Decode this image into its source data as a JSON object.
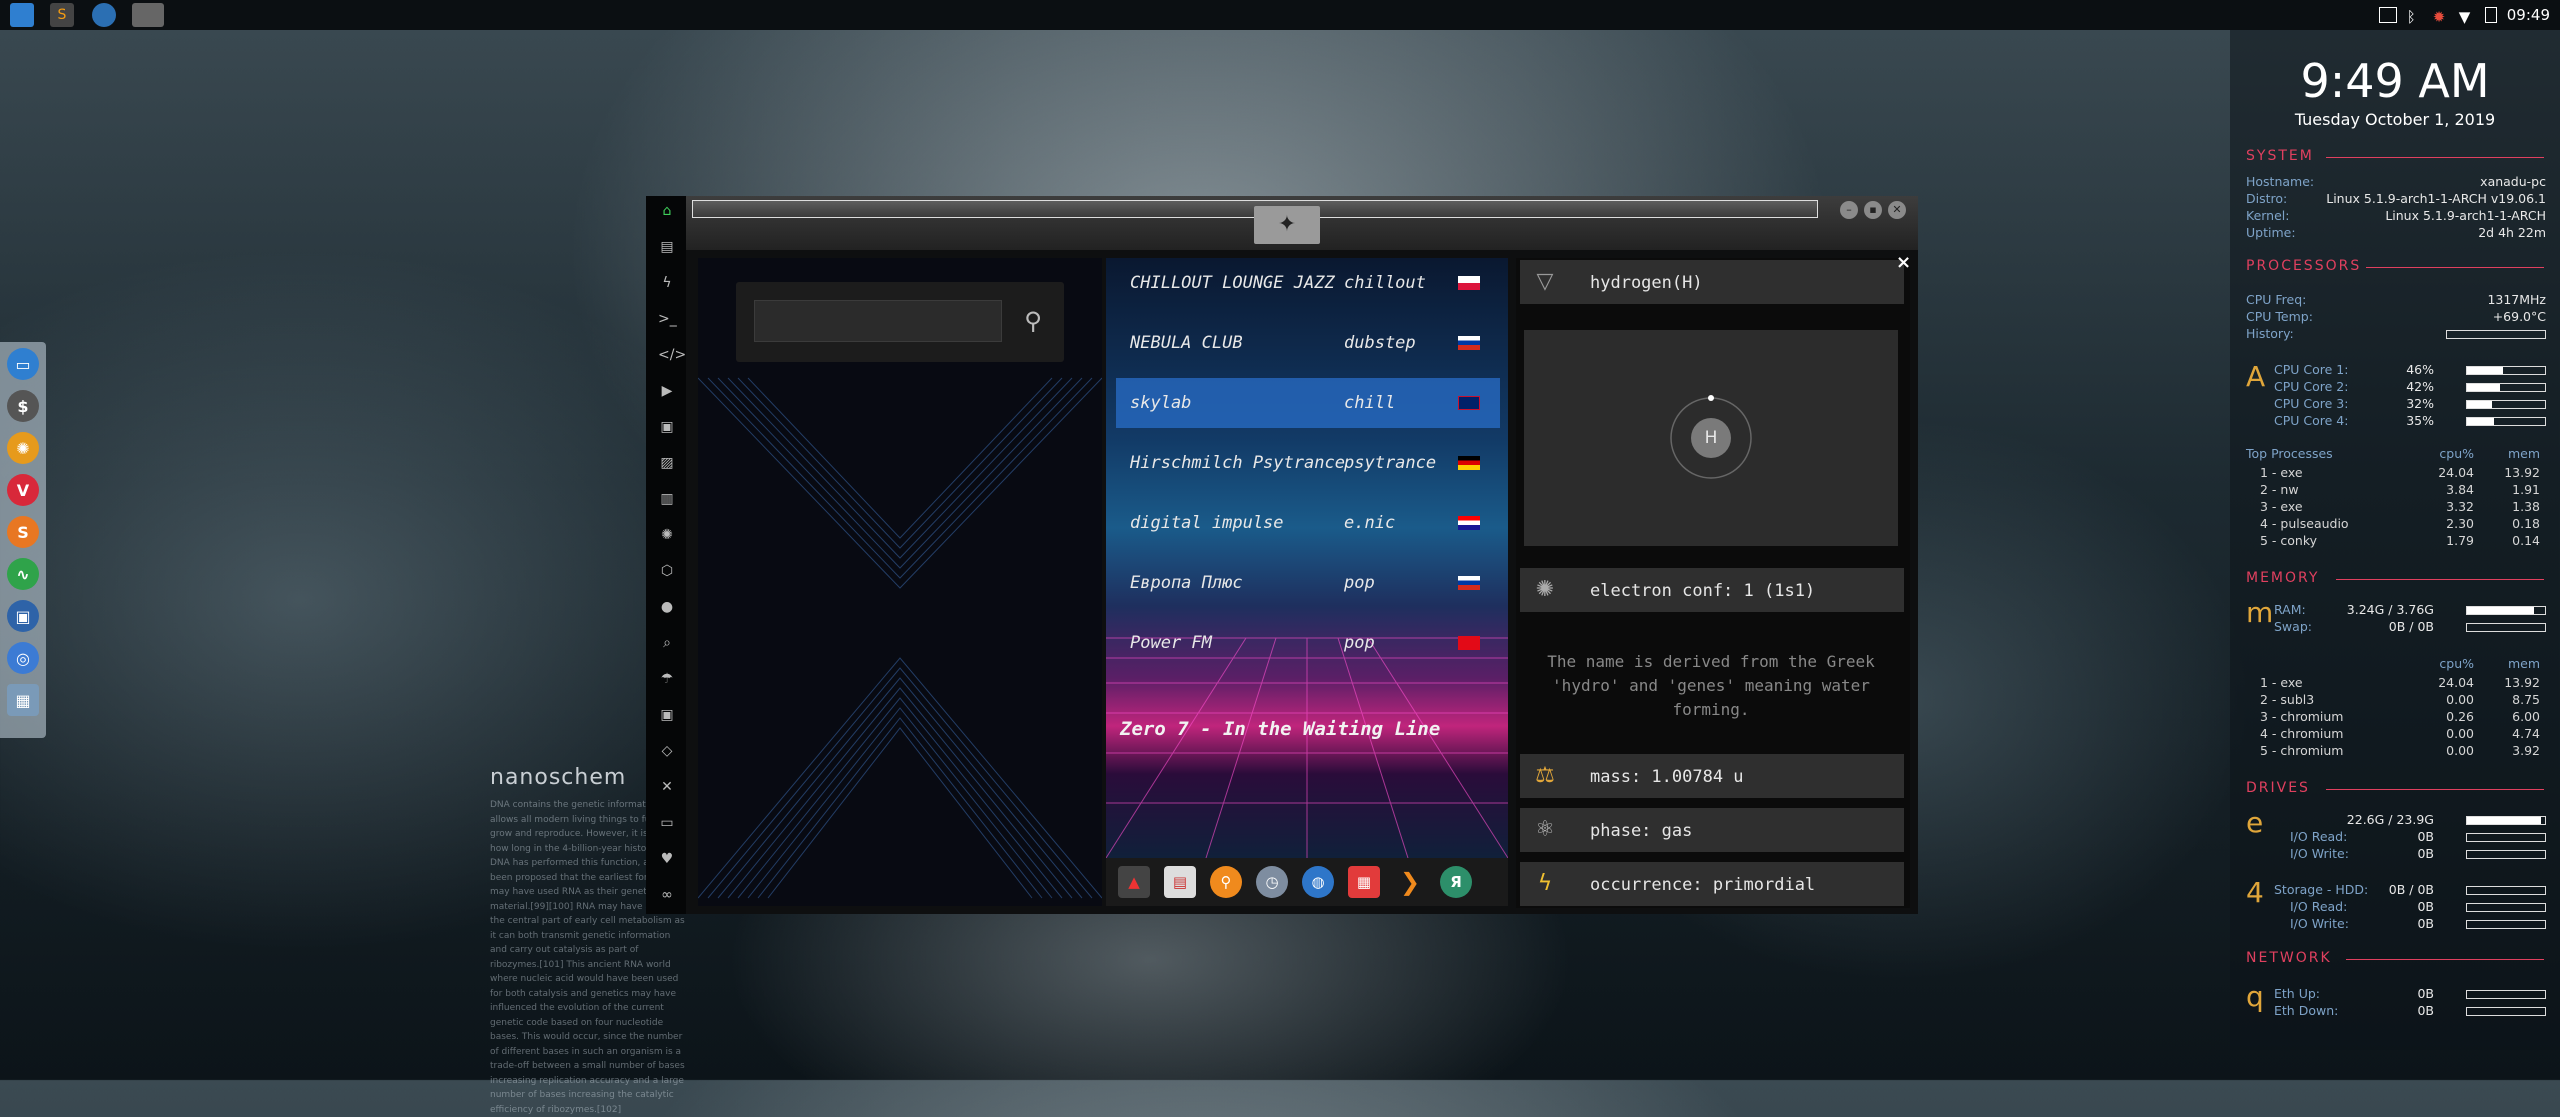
{
  "taskbar": {
    "time": "09:49"
  },
  "search": {
    "placeholder": ""
  },
  "stations": [
    {
      "name": "CHILLOUT LOUNGE JAZZ",
      "genre": "chillout",
      "flag": "poland"
    },
    {
      "name": "NEBULA CLUB",
      "genre": "dubstep",
      "flag": "russia"
    },
    {
      "name": "skylab",
      "genre": "chill",
      "flag": "uk"
    },
    {
      "name": "Hirschmilch Psytrance",
      "genre": "psytrance",
      "flag": "germany"
    },
    {
      "name": "digital impulse",
      "genre": "e.nic",
      "flag": "croatia"
    },
    {
      "name": "Европа Плюс",
      "genre": "pop",
      "flag": "russia"
    },
    {
      "name": "Power FM",
      "genre": "pop",
      "flag": "turkey"
    }
  ],
  "now_playing": "Zero 7 - In the Waiting Line",
  "element": {
    "name": "hydrogen(H)",
    "symbol": "H",
    "electron_conf": "electron conf: 1 (1s1)",
    "description": "The name is derived from the Greek 'hydro' and 'genes' meaning water forming.",
    "mass": "mass: 1.00784 u",
    "phase": "phase: gas",
    "occurrence": "occurrence: primordial"
  },
  "nanoschem": {
    "title": "nanoschem",
    "body": "DNA contains the genetic information that allows all modern living things to function, grow and reproduce. However, it is unclear how long in the 4-billion-year history of life DNA has performed this function, as it has been proposed that the earliest forms of life may have used RNA as their genetic material.[99][100] RNA may have acted as the central part of early cell metabolism as it can both transmit genetic information and carry out catalysis as part of ribozymes.[101] This ancient RNA world where nucleic acid would have been used for both catalysis and genetics may have influenced the evolution of the current genetic code based on four nucleotide bases. This would occur, since the number of different bases in such an organism is a trade-off between a small number of bases increasing replication accuracy and a large number of bases increasing the catalytic efficiency of ribozymes.[102]"
  },
  "conky": {
    "time": "9:49 AM",
    "date": "Tuesday October  1, 2019",
    "system_title": "SYSTEM",
    "system": [
      {
        "k": "Hostname:",
        "v": "xanadu-pc"
      },
      {
        "k": "Distro:",
        "v": "Linux 5.1.9-arch1-1-ARCH v19.06.1"
      },
      {
        "k": "Kernel:",
        "v": "Linux 5.1.9-arch1-1-ARCH"
      },
      {
        "k": "Uptime:",
        "v": "2d 4h 22m"
      }
    ],
    "processors_title": "PROCESSORS",
    "cpu_freq": {
      "k": "CPU Freq:",
      "v": "1317MHz"
    },
    "cpu_temp": {
      "k": "CPU Temp:",
      "v": "+69.0°C"
    },
    "history": "History:",
    "cpu_letter": "A",
    "cores": [
      {
        "k": "CPU Core 1:",
        "v": "46%",
        "pct": 46
      },
      {
        "k": "CPU Core 2:",
        "v": "42%",
        "pct": 42
      },
      {
        "k": "CPU Core 3:",
        "v": "32%",
        "pct": 32
      },
      {
        "k": "CPU Core 4:",
        "v": "35%",
        "pct": 35
      }
    ],
    "top_title": "Top Processes",
    "top_cpu": "cpu%",
    "top_mem": "mem",
    "top_cpu_list": [
      {
        "n": "1 - exe",
        "c": "24.04",
        "m": "13.92"
      },
      {
        "n": "2 - nw",
        "c": "3.84",
        "m": "1.91"
      },
      {
        "n": "3 - exe",
        "c": "3.32",
        "m": "1.38"
      },
      {
        "n": "4 - pulseaudio",
        "c": "2.30",
        "m": "0.18"
      },
      {
        "n": "5 - conky",
        "c": "1.79",
        "m": "0.14"
      }
    ],
    "memory_title": "MEMORY",
    "mem_letter": "m",
    "ram": {
      "k": "RAM:",
      "v": "3.24G / 3.76G",
      "pct": 86
    },
    "swap": {
      "k": "Swap:",
      "v": "0B / 0B",
      "pct": 0
    },
    "mem_top_cpu": "cpu%",
    "mem_top_mem": "mem",
    "top_mem_list": [
      {
        "n": "1 - exe",
        "c": "24.04",
        "m": "13.92"
      },
      {
        "n": "2 - subl3",
        "c": "0.00",
        "m": "8.75"
      },
      {
        "n": "3 - chromium",
        "c": "0.26",
        "m": "6.00"
      },
      {
        "n": "4 - chromium",
        "c": "0.00",
        "m": "4.74"
      },
      {
        "n": "5 - chromium",
        "c": "0.00",
        "m": "3.92"
      }
    ],
    "drives_title": "DRIVES",
    "drive1_letter": "e",
    "drive1": {
      "v": "22.6G / 23.9G",
      "pct": 95
    },
    "drive1_read": {
      "k": "I/O Read:",
      "v": "0B"
    },
    "drive1_write": {
      "k": "I/O Write:",
      "v": "0B"
    },
    "drive2_letter": "4",
    "drive2": {
      "k": "Storage - HDD:",
      "v": "0B / 0B"
    },
    "drive2_read": {
      "k": "I/O Read:",
      "v": "0B"
    },
    "drive2_write": {
      "k": "I/O Write:",
      "v": "0B"
    },
    "network_title": "NETWORK",
    "net_letter": "q",
    "eth_up": {
      "k": "Eth Up:",
      "v": "0B"
    },
    "eth_down": {
      "k": "Eth Down:",
      "v": "0B"
    }
  },
  "colors": {
    "accent": "#e0405f",
    "orange": "#e0a63a",
    "selected_row": "#286ec8"
  }
}
